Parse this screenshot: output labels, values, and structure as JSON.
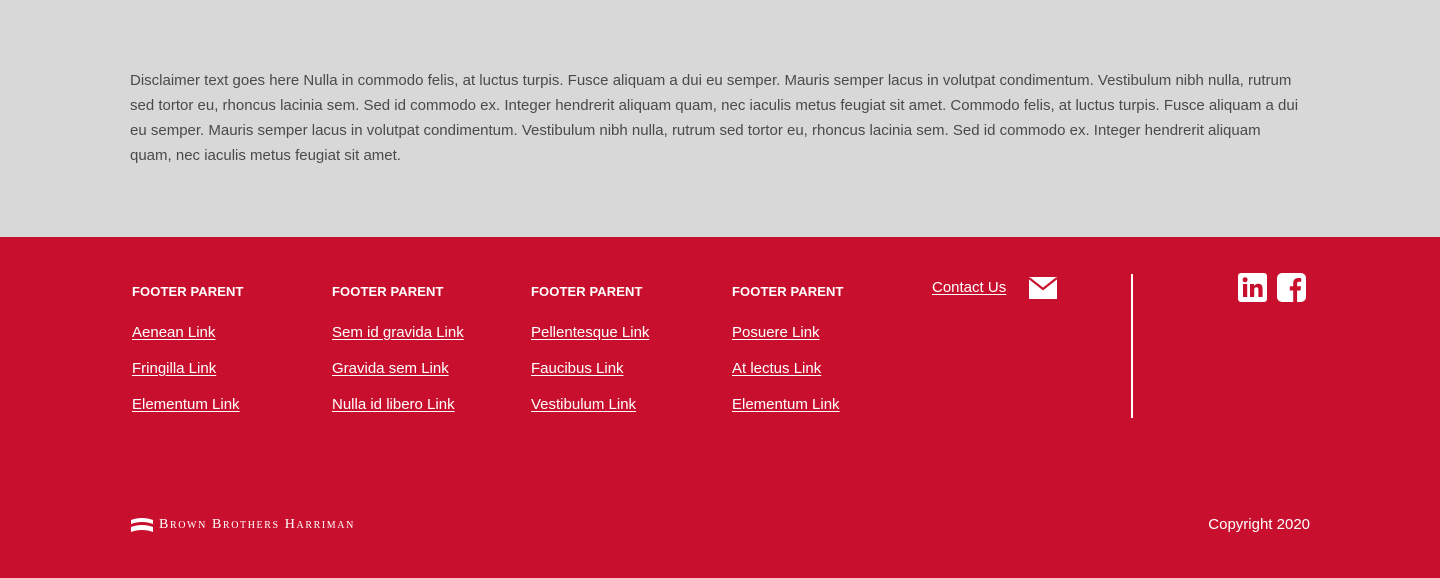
{
  "disclaimer": {
    "text": "Disclaimer text goes here Nulla in commodo felis, at luctus turpis. Fusce aliquam a dui eu semper. Mauris semper lacus in volutpat condimentum. Vestibulum nibh nulla, rutrum sed tortor eu, rhoncus lacinia sem. Sed id commodo ex. Integer hendrerit aliquam quam, nec iaculis metus feugiat sit amet. Commodo felis, at luctus turpis. Fusce aliquam a dui eu semper. Mauris semper lacus in volutpat condimentum. Vestibulum nibh nulla, rutrum sed tortor eu, rhoncus lacinia sem. Sed id commodo ex. Integer hendrerit aliquam quam, nec iaculis metus feugiat sit amet."
  },
  "footer": {
    "columns": [
      {
        "heading": "FOOTER PARENT",
        "links": [
          "Aenean Link",
          "Fringilla Link",
          "Elementum Link"
        ]
      },
      {
        "heading": "FOOTER PARENT",
        "links": [
          "Sem id gravida Link",
          "Gravida sem Link",
          "Nulla id libero Link"
        ]
      },
      {
        "heading": "FOOTER PARENT",
        "links": [
          "Pellentesque Link",
          "Faucibus Link",
          "Vestibulum Link"
        ]
      },
      {
        "heading": "FOOTER PARENT",
        "links": [
          "Posuere Link",
          "At lectus Link",
          "Elementum Link"
        ]
      }
    ],
    "contact_label": "Contact Us",
    "contact_icon": "mail-icon",
    "social": [
      "linkedin-icon",
      "facebook-icon"
    ],
    "logo_text": "Brown Brothers Harriman",
    "copyright": "Copyright 2020"
  },
  "colors": {
    "disclaimer_bg": "#d8d8d8",
    "footer_bg": "#c8102e",
    "text_light": "#ffffff",
    "text_dark": "#4a4a4a"
  }
}
